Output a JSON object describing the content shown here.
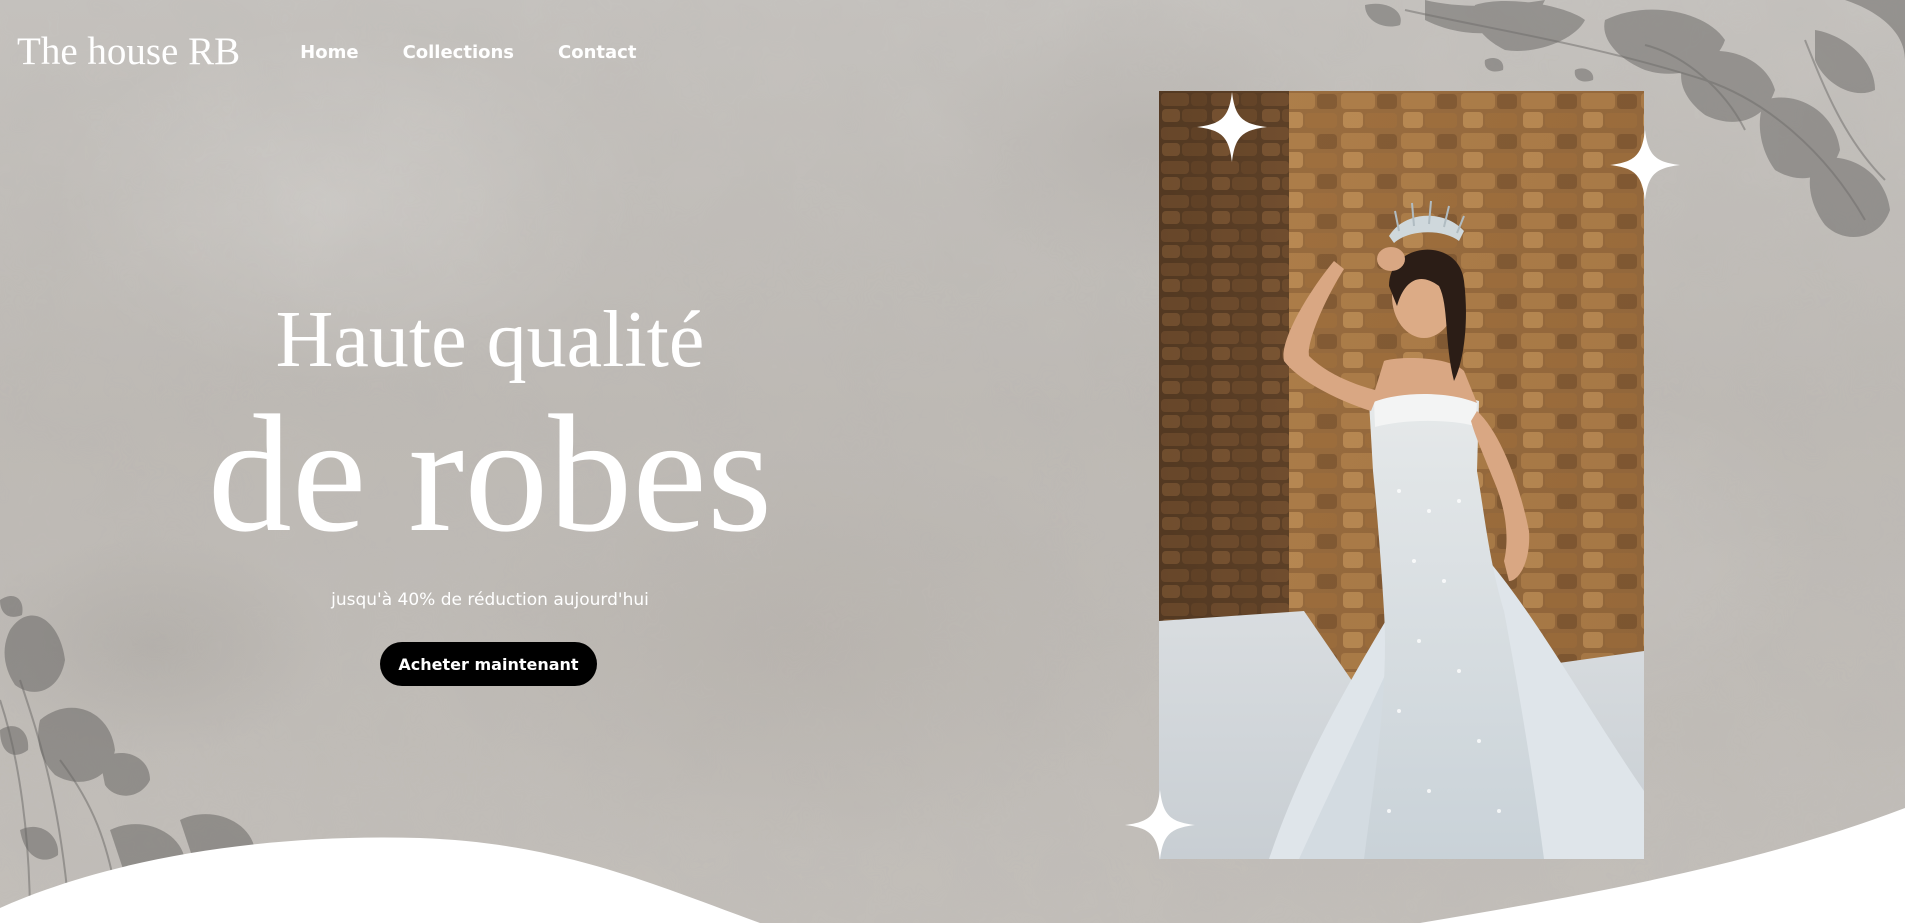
{
  "header": {
    "brand": "The house RB",
    "nav": [
      {
        "label": "Home"
      },
      {
        "label": "Collections"
      },
      {
        "label": "Contact"
      }
    ]
  },
  "hero": {
    "title_line1": "Haute qualité",
    "title_line2": "de robes",
    "subtitle": "jusqu'à 40% de réduction aujourd'hui",
    "cta_label": "Acheter maintenant"
  },
  "photo": {
    "description_icon": "bride-photo",
    "alt": "Mariée en robe blanche devant un mur de pierres"
  },
  "colors": {
    "text": "#ffffff",
    "button": "#000000",
    "background": "#c2beb9"
  }
}
